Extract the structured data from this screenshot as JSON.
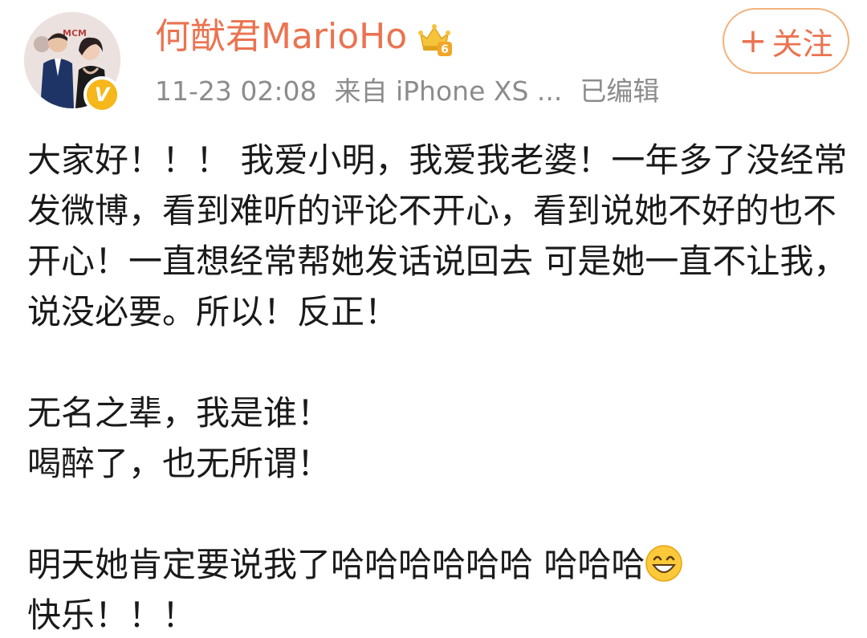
{
  "post_header": {
    "username": "何猷君MarioHo",
    "member_level": "6",
    "timestamp": "11-23 02:08",
    "source": "来自 iPhone XS ...",
    "edited_label": "已编辑",
    "verified_badge": "V",
    "follow_button": {
      "plus": "+",
      "label": "关注"
    }
  },
  "post_body": {
    "paragraph1": "大家好！！！ 我爱小明，我爱我老婆！一年多了没经常发微博，看到难听的评论不开心，看到说她不好的也不开心！一直想经常帮她发话说回去 可是她一直不让我，说没必要。所以！反正！",
    "line2": "无名之辈，我是谁！",
    "line3": "喝醉了，也无所谓！",
    "line4": "明天她肯定要说我了哈哈哈哈哈哈 哈哈哈",
    "line5": "快乐！！！"
  },
  "colors": {
    "accent": "#eb7350",
    "button_border": "#f2b27c",
    "meta_text": "#8c8c8c",
    "body_text": "#1a1a1a",
    "verified": "#f5b71a"
  },
  "icons": {
    "member_crown": "crown-icon",
    "emoji": "grin-emoji-icon",
    "verified": "verified-v-icon"
  }
}
